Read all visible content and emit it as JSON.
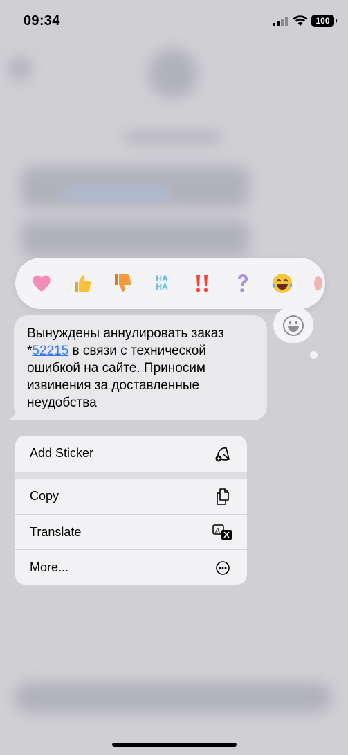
{
  "status_bar": {
    "time": "09:34",
    "battery": "100",
    "icons": [
      "signal-icon",
      "wifi-icon",
      "battery-icon"
    ]
  },
  "reactions": [
    {
      "name": "heart",
      "glyph": "💗"
    },
    {
      "name": "thumbs-up",
      "glyph": "👍"
    },
    {
      "name": "thumbs-down",
      "glyph": "👎"
    },
    {
      "name": "haha",
      "glyph": "HA HA"
    },
    {
      "name": "exclamation",
      "glyph": "‼️"
    },
    {
      "name": "question",
      "glyph": "?"
    },
    {
      "name": "laughing",
      "glyph": "😂"
    }
  ],
  "message": {
    "text_before": "Вынуждены аннулировать заказ *",
    "link": "52215",
    "text_after": " в связи с технической ошибкой на сайте. Приносим извинения за доставленные неудобства"
  },
  "menu": {
    "items": [
      {
        "label": "Add Sticker",
        "icon": "sticker-icon"
      },
      {
        "label": "Copy",
        "icon": "copy-icon"
      },
      {
        "label": "Translate",
        "icon": "translate-icon"
      },
      {
        "label": "More...",
        "icon": "more-icon"
      }
    ]
  },
  "colors": {
    "link": "#3478f6",
    "bubble": "#e9e9eb",
    "menu_bg": "#f2f2f4",
    "backdrop": "#cfcfd4"
  }
}
